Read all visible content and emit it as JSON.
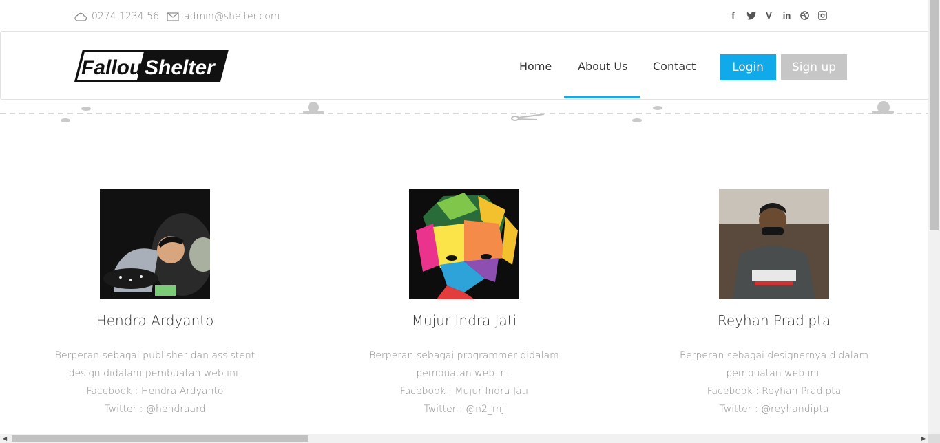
{
  "topbar": {
    "phone": "0274 1234 56",
    "email": "admin@shelter.com",
    "social_icons": [
      "facebook-icon",
      "twitter-icon",
      "vine-icon",
      "linkedin-icon",
      "dribbble-icon",
      "instagram-icon"
    ]
  },
  "navbar": {
    "logo_text_1": "Fallout",
    "logo_text_2": "Shelter",
    "links": [
      "Home",
      "About Us",
      "Contact"
    ],
    "active_link": "About Us",
    "login_label": "Login",
    "signup_label": "Sign up"
  },
  "team": [
    {
      "name": "Hendra Ardyanto",
      "desc": "Berperan sebagai publisher dan assistent design didalam pembuatan web ini.",
      "facebook": "Facebook : Hendra Ardyanto",
      "twitter": "Twitter : @hendraard"
    },
    {
      "name": "Mujur Indra Jati",
      "desc": "Berperan sebagai programmer didalam pembuatan web ini.",
      "facebook": "Facebook : Mujur Indra Jati",
      "twitter": "Twitter : @n2_mj"
    },
    {
      "name": "Reyhan Pradipta",
      "desc": "Berperan sebagai designernya didalam pembuatan web ini.",
      "facebook": "Facebook : Reyhan Pradipta",
      "twitter": "Twitter : @reyhandipta"
    }
  ],
  "colors": {
    "accent": "#10a9ea",
    "signup": "#c6c6c6",
    "active_underline": "#1aa8e0"
  }
}
